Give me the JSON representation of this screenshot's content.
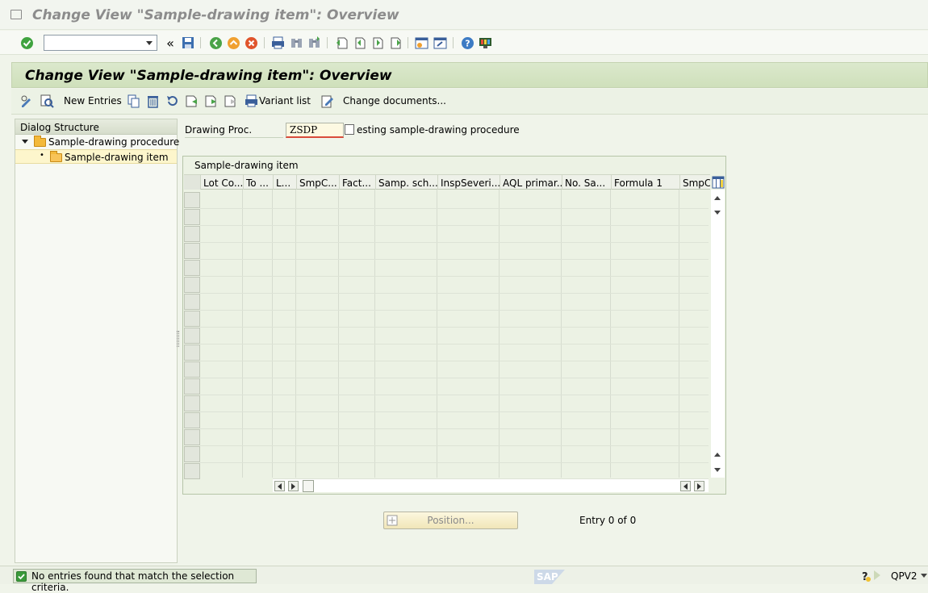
{
  "window": {
    "title": "Change View \"Sample-drawing item\": Overview"
  },
  "header": {
    "title": "Change View \"Sample-drawing item\": Overview"
  },
  "app_toolbar": {
    "new_entries": "New Entries",
    "variant_list": "Variant list",
    "change_documents": "Change documents..."
  },
  "dialog_structure": {
    "title": "Dialog Structure",
    "items": [
      {
        "label": "Sample-drawing procedure"
      },
      {
        "label": "Sample-drawing item"
      }
    ]
  },
  "field": {
    "label": "Drawing Proc.",
    "value": "ZSDP",
    "description": "esting sample-drawing procedure"
  },
  "table": {
    "caption": "Sample-drawing item",
    "columns": [
      "Lot Co...",
      "To ...",
      "L...",
      "SmpC...",
      "Fact...",
      "Samp. sch...",
      "InspSeveri...",
      "AQL primar...",
      "No. Sa...",
      "Formula 1",
      "SmpC."
    ]
  },
  "position_button": "Position...",
  "entry_info": "Entry 0 of 0",
  "status": {
    "message": "No entries found that match the selection criteria.",
    "system": "QPV2",
    "logo": "SAP"
  }
}
